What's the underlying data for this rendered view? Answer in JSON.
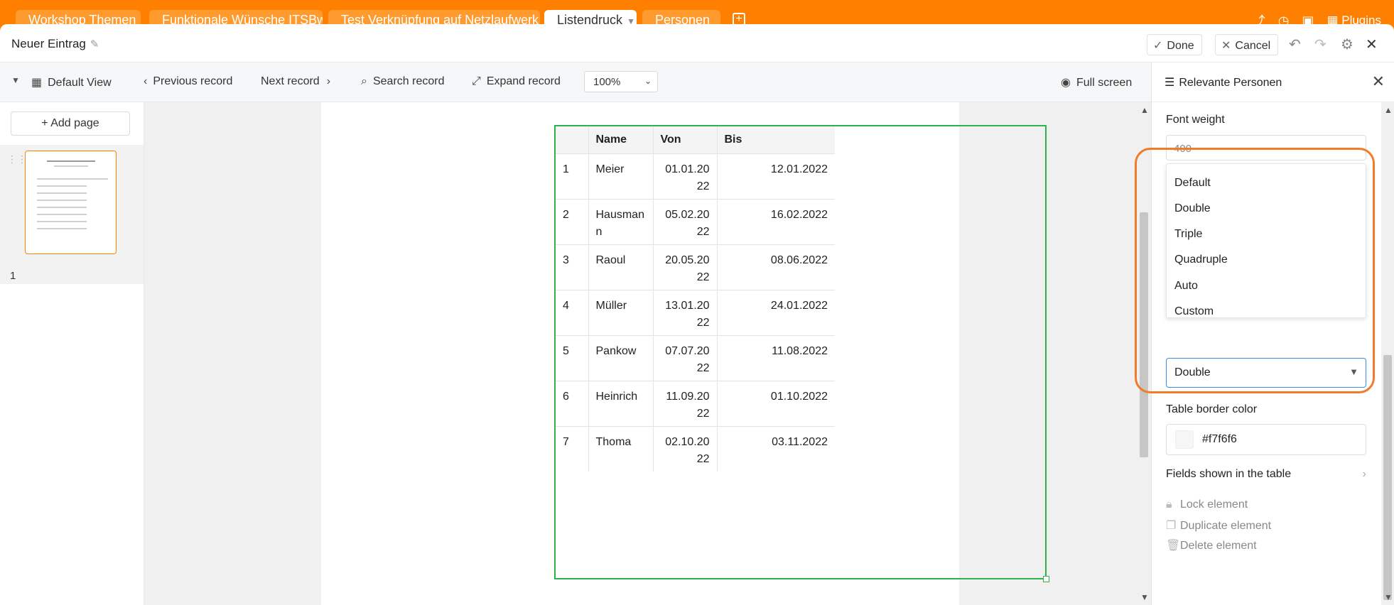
{
  "tabs": [
    {
      "label": "Workshop Themen"
    },
    {
      "label": "Funktionale Wünsche ITSBw"
    },
    {
      "label": "Test Verknüpfung auf Netzlaufwerk"
    },
    {
      "label": "Listendruck"
    },
    {
      "label": "Personen"
    }
  ],
  "topbar": {
    "plugins_label": "Plugins"
  },
  "header": {
    "title": "Neuer Eintrag",
    "done_label": "Done",
    "cancel_label": "Cancel"
  },
  "toolbar": {
    "view_label": "Default View",
    "previous_label": "Previous record",
    "next_label": "Next record",
    "search_label": "Search record",
    "expand_label": "Expand record",
    "zoom_value": "100%",
    "fullscreen_label": "Full screen"
  },
  "pages": {
    "add_label": "Add page",
    "page_number": "1"
  },
  "table": {
    "columns": [
      "",
      "Name",
      "Von",
      "Bis"
    ],
    "rows": [
      {
        "num": "1",
        "name": "Meier",
        "von": "01.01.2022",
        "bis": "12.01.2022"
      },
      {
        "num": "2",
        "name": "Hausmann",
        "von": "05.02.2022",
        "bis": "16.02.2022"
      },
      {
        "num": "3",
        "name": "Raoul",
        "von": "20.05.2022",
        "bis": "08.06.2022"
      },
      {
        "num": "4",
        "name": "Müller",
        "von": "13.01.2022",
        "bis": "24.01.2022"
      },
      {
        "num": "5",
        "name": "Pankow",
        "von": "07.07.2022",
        "bis": "11.08.2022"
      },
      {
        "num": "6",
        "name": "Heinrich",
        "von": "11.09.2022",
        "bis": "01.10.2022"
      },
      {
        "num": "7",
        "name": "Thoma",
        "von": "02.10.2022",
        "bis": "03.11.2022"
      }
    ]
  },
  "panel": {
    "title": "Relevante Personen",
    "font_weight_label": "Font weight",
    "font_weight_value": "400",
    "dropdown_options": [
      "Default",
      "Double",
      "Triple",
      "Quadruple",
      "Auto",
      "Custom"
    ],
    "selected_value": "Double",
    "border_color_label": "Table border color",
    "border_color_value": "#f7f6f6",
    "fields_label": "Fields shown in the table",
    "lock_label": "Lock element",
    "duplicate_label": "Duplicate element",
    "delete_label": "Delete element"
  },
  "colors": {
    "accent": "#ff8000",
    "frame": "#2bb24c",
    "focus": "#3d8de8",
    "swatch": "#f7f6f6"
  }
}
